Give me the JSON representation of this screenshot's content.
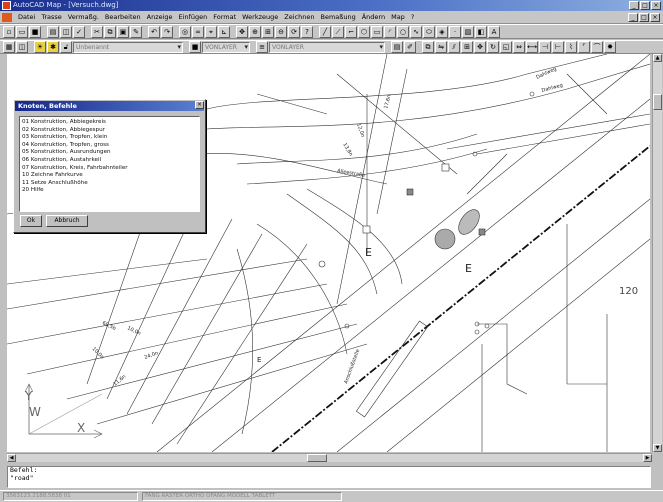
{
  "window": {
    "title": "AutoCAD Map - [Versuch.dwg]",
    "min_glyph": "_",
    "max_glyph": "□",
    "close_glyph": "×"
  },
  "menu": {
    "items": [
      "Datei",
      "Trasse",
      "Vermaßg.",
      "Bearbeiten",
      "Anzeige",
      "Einfügen",
      "Format",
      "Werkzeuge",
      "Zeichnen",
      "Bemaßung",
      "Ändern",
      "Map",
      "?"
    ]
  },
  "toolbar_layer": {
    "layer_value": "Unbenannt",
    "layer_combo": "VONLAYER",
    "linetype_combo": "VONLAYER"
  },
  "drawing": {
    "labels": {
      "e1": "E",
      "e2": "E",
      "e3": "E",
      "number_120": "120",
      "street_top": "Dahlweg",
      "street_right": "Dahlweg",
      "street_mid": "Alleestraße",
      "street_center": "Anschlußstelle",
      "dim1": "68,5b",
      "dim2": "10,0n",
      "dim3": "10,0n",
      "dim4": "24,0n",
      "dim5": "11,6n",
      "dim6": "13,8n",
      "dim7": "17,6n",
      "dim8": "12,0n"
    },
    "ucs_labels": {
      "y": "Y",
      "w": "W",
      "x": "X"
    }
  },
  "dialog": {
    "title": "Knoten, Befehle",
    "close_glyph": "×",
    "items": [
      "01 Konstruktion, Abbiegekreis",
      "02 Konstruktion, Abbiegespur",
      "03 Konstruktion, Tropfen, klein",
      "04 Konstruktion, Tropfen, gross",
      "05 Konstruktion, Ausrundungen",
      "06 Konstruktion, Austahrkeil",
      "07 Konstruktion, Kreis, Fahrbahnteiler",
      "10 Zeichne Fahrkurve",
      "11 Setze Anschlußhöhe",
      "20 Hilfe"
    ],
    "ok_label": "Ok",
    "cancel_label": "Abbruch"
  },
  "command": {
    "line1": "Befehl:",
    "line2": "\"road\""
  },
  "status": {
    "coords": "3563123.2188,5838 01",
    "modes": "FANG  RASTER  ORTHO  OFANG  MODELL  TABLETT"
  }
}
